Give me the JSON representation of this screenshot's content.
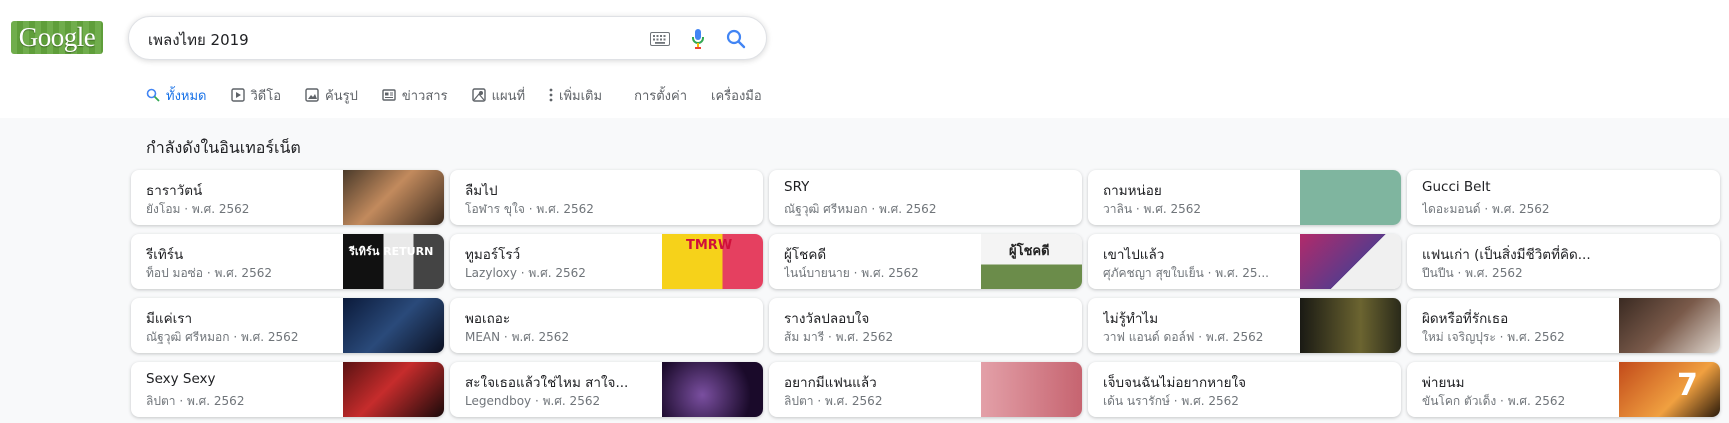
{
  "logo": {
    "text": "Google"
  },
  "search": {
    "query": "เพลงไทย 2019"
  },
  "icons": {
    "keyboard": "keyboard-icon",
    "mic": "microphone-icon",
    "search": "search-icon"
  },
  "colors": {
    "accent": "#1a73e8",
    "logo_bg": "#64a63d",
    "results_bg": "#f8f9fa"
  },
  "tabs": [
    {
      "label": "ทั้งหมด",
      "icon": "search-icon",
      "active": true
    },
    {
      "label": "วิดีโอ",
      "icon": "video-icon"
    },
    {
      "label": "ค้นรูป",
      "icon": "image-icon"
    },
    {
      "label": "ข่าวสาร",
      "icon": "news-icon"
    },
    {
      "label": "แผนที่",
      "icon": "map-icon"
    },
    {
      "label": "เพิ่มเติม",
      "icon": "more-vert-icon"
    },
    {
      "label": "การตั้งค่า"
    },
    {
      "label": "เครื่องมือ"
    }
  ],
  "section": {
    "title": "กำลังดังในอินเทอร์เน็ต"
  },
  "cards": [
    {
      "title": "ธาราวัตน์",
      "subtitle": "ยังโอม · พ.ศ. 2562",
      "thumb": true
    },
    {
      "title": "ลืมไป",
      "subtitle": "โอฬาร ขุใจ · พ.ศ. 2562",
      "thumb": false
    },
    {
      "title": "SRY",
      "subtitle": "ณัฐวุฒิ ศรีหมอก · พ.ศ. 2562",
      "thumb": false
    },
    {
      "title": "ถามหน่อย",
      "subtitle": "วาลิน · พ.ศ. 2562",
      "thumb": true
    },
    {
      "title": "Gucci Belt",
      "subtitle": "ไดอะมอนด์ · พ.ศ. 2562",
      "thumb": false
    },
    {
      "title": "รีเทิร์น",
      "subtitle": "ท็อป มอซ่อ · พ.ศ. 2562",
      "thumb": true,
      "thumb_text": "รีเทิร์น RETURN"
    },
    {
      "title": "ทูมอร์โรว์",
      "subtitle": "Lazyloxy · พ.ศ. 2562",
      "thumb": true,
      "thumb_text": "TMRW"
    },
    {
      "title": "ผู้โชคดี",
      "subtitle": "ไนน์บายนาย · พ.ศ. 2562",
      "thumb": true,
      "thumb_text": "ผู้โชคดี"
    },
    {
      "title": "เขาไปแล้ว",
      "subtitle": "ศุภัคชญา สุขใบเย็น · พ.ศ. 25...",
      "thumb": true
    },
    {
      "title": "แฟนเก่า (เป็นสิ่งมีชีวิตที่คิด...",
      "subtitle": "ปีนปีน · พ.ศ. 2562",
      "thumb": false
    },
    {
      "title": "มีแค่เรา",
      "subtitle": "ณัฐวุฒิ ศรีหมอก · พ.ศ. 2562",
      "thumb": true
    },
    {
      "title": "พอเถอะ",
      "subtitle": "MEAN · พ.ศ. 2562",
      "thumb": false
    },
    {
      "title": "รางวัลปลอบใจ",
      "subtitle": "ส้ม มารี · พ.ศ. 2562",
      "thumb": false
    },
    {
      "title": "ไม่รู้ทำไม",
      "subtitle": "วาฟ แอนด์ ดอล์ฟ · พ.ศ. 2562",
      "thumb": true
    },
    {
      "title": "ผิดหรือที่รักเธอ",
      "subtitle": "ใหม่ เจริญปุระ · พ.ศ. 2562",
      "thumb": true
    },
    {
      "title": "Sexy Sexy",
      "subtitle": "ลิปตา · พ.ศ. 2562",
      "thumb": true
    },
    {
      "title": "สะใจเธอแล้วใช่ไหม สาใจ...",
      "subtitle": "Legendboy · พ.ศ. 2562",
      "thumb": true
    },
    {
      "title": "อยากมีแฟนแล้ว",
      "subtitle": "ลิปตา · พ.ศ. 2562",
      "thumb": true
    },
    {
      "title": "เจ็บจนฉันไม่อยากหายใจ",
      "subtitle": "เด้น นรารักษ์ · พ.ศ. 2562",
      "thumb": false
    },
    {
      "title": "พ่ายนม",
      "subtitle": "ขันโคก ตัวเด็ง · พ.ศ. 2562",
      "thumb": true,
      "thumb_text": "7"
    }
  ]
}
